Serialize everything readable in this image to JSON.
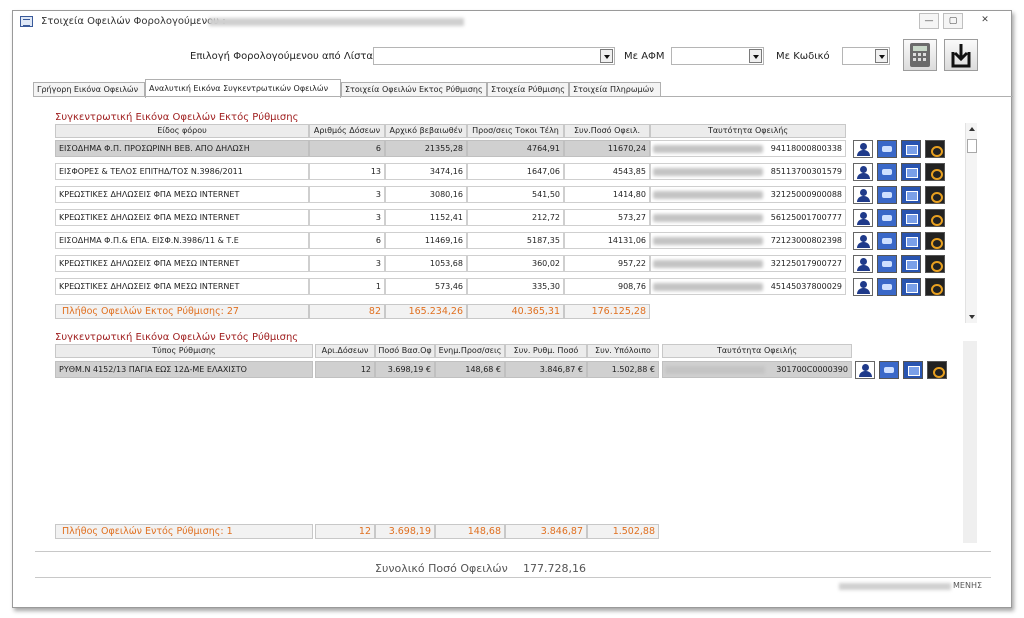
{
  "window": {
    "title": "Στοιχεία Οφειλών Φορολογούμενου :",
    "minimize": "—",
    "restore": "▢",
    "close": "✕"
  },
  "toolbar": {
    "select_label": "Επιλογή Φορολογούμενου από Λίστα",
    "afm_label": "Με ΑΦΜ",
    "code_label": "Με Κωδικό"
  },
  "tabs": [
    {
      "label": "Γρήγορη Εικόνα Οφειλών"
    },
    {
      "label": "Αναλυτική Εικόνα Συγκεντρωτικών Οφειλών"
    },
    {
      "label": "Στοιχεία Οφειλών Εκτος Ρύθμισης"
    },
    {
      "label": "Στοιχεία Ρύθμισης"
    },
    {
      "label": "Στοιχεία Πληρωμών"
    }
  ],
  "outside": {
    "title": "Συγκεντρωτική Εικόνα Οφειλών Εκτός Ρύθμισης",
    "headers": [
      "Είδος φόρου",
      "Αριθμός Δόσεων",
      "Αρχικό βεβαιωθέν",
      "Προσ/σεις Τοκοι Τέλη",
      "Συν.Ποσό Οφειλ.",
      "Ταυτότητα Οφειλής"
    ],
    "rows": [
      {
        "type": "ΕΙΣΟΔΗΜΑ Φ.Π. ΠΡΟΣΩΡΙΝΗ ΒΕΒ. ΑΠΟ ΔΗΛΩΣΗ",
        "installments": "6",
        "initial": "21355,28",
        "surcharges": "4764,91",
        "total": "11670,24",
        "id": "94118000800338"
      },
      {
        "type": "ΕΙΣΦΟΡΕΣ & ΤΕΛΟΣ ΕΠΙΤΗΔ/ΤΟΣ Ν.3986/2011",
        "installments": "13",
        "initial": "3474,16",
        "surcharges": "1647,06",
        "total": "4543,85",
        "id": "85113700301579"
      },
      {
        "type": "ΚΡΕΩΣΤΙΚΕΣ ΔΗΛΩΣΕΙΣ ΦΠΑ ΜΕΣΩ INTERNET",
        "installments": "3",
        "initial": "3080,16",
        "surcharges": "541,50",
        "total": "1414,80",
        "id": "32125000900088"
      },
      {
        "type": "ΚΡΕΩΣΤΙΚΕΣ ΔΗΛΩΣΕΙΣ ΦΠΑ ΜΕΣΩ INTERNET",
        "installments": "3",
        "initial": "1152,41",
        "surcharges": "212,72",
        "total": "573,27",
        "id": "56125001700777"
      },
      {
        "type": "ΕΙΣΟΔΗΜΑ Φ.Π.& ΕΠΑ. ΕΙΣΦ.Ν.3986/11 & Τ.Ε",
        "installments": "6",
        "initial": "11469,16",
        "surcharges": "5187,35",
        "total": "14131,06",
        "id": "72123000802398"
      },
      {
        "type": "ΚΡΕΩΣΤΙΚΕΣ ΔΗΛΩΣΕΙΣ ΦΠΑ ΜΕΣΩ INTERNET",
        "installments": "3",
        "initial": "1053,68",
        "surcharges": "360,02",
        "total": "957,22",
        "id": "32125017900727"
      },
      {
        "type": "ΚΡΕΩΣΤΙΚΕΣ ΔΗΛΩΣΕΙΣ ΦΠΑ ΜΕΣΩ INTERNET",
        "installments": "1",
        "initial": "573,46",
        "surcharges": "335,30",
        "total": "908,76",
        "id": "45145037800029"
      }
    ],
    "summary": {
      "label": "Πλήθος Οφειλών Εκτος Ρύθμισης: 27",
      "installments": "82",
      "initial": "165.234,26",
      "surcharges": "40.365,31",
      "total": "176.125,28"
    }
  },
  "inside": {
    "title": "Συγκεντρωτική Εικόνα Οφειλών Εντός Ρύθμισης",
    "headers": [
      "Τύπος Ρύθμισης",
      "Αρι.Δόσεων",
      "Ποσό Βασ.Οφ",
      "Ενημ.Προσ/σεις",
      "Συν. Ρυθμ. Ποσό",
      "Συν. Υπόλοιπο",
      "Ταυτότητα Οφειλής"
    ],
    "rows": [
      {
        "type": "ΡΥΘΜ.Ν 4152/13 ΠΑΓΙΑ ΕΩΣ 12Δ-ΜΕ ΕΛΑΧΙΣΤΟ",
        "installments": "12",
        "base": "3.698,19 €",
        "updated": "148,68 €",
        "total": "3.846,87 €",
        "balance": "1.502,88 €",
        "id": "301700C0000390"
      }
    ],
    "summary": {
      "label": "Πλήθος Οφειλών Εντός Ρύθμισης: 1",
      "installments": "12",
      "base": "3.698,19",
      "updated": "148,68",
      "total": "3.846,87",
      "balance": "1.502,88"
    }
  },
  "footer": {
    "total_label": "Συνολικό Ποσό Οφειλών",
    "total_value": "177.728,16",
    "status_suffix": "ΜΕΝΗΣ"
  },
  "icons": {
    "user": "user-icon",
    "screen": "monitor-icon",
    "mail": "mail-icon",
    "lock": "lock-icon",
    "calculator": "calculator-icon",
    "export": "export-icon"
  }
}
